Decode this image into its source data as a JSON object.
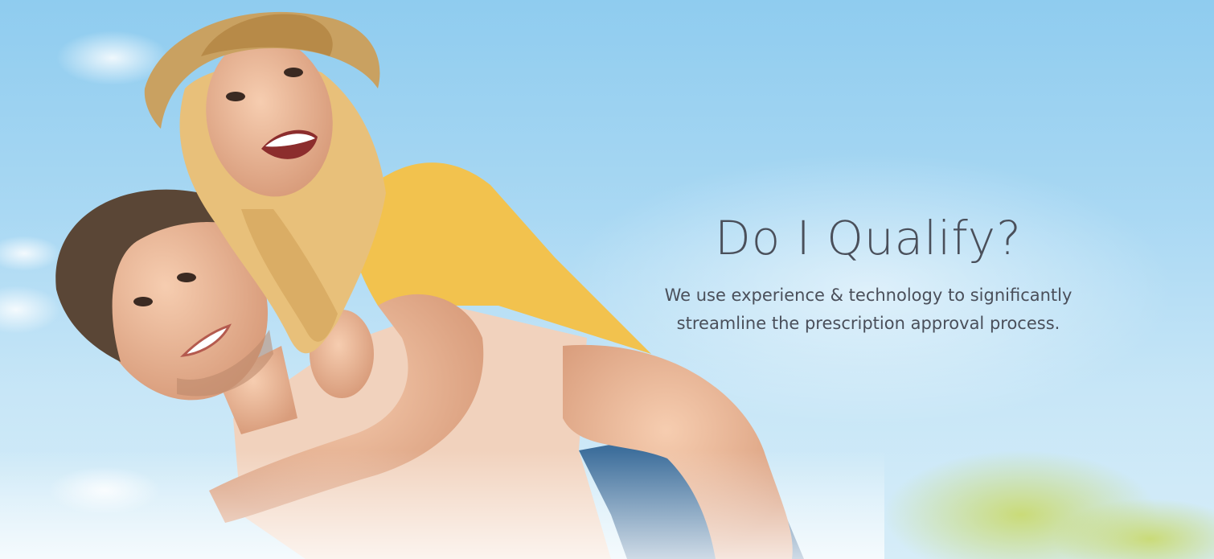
{
  "hero": {
    "headline": "Do I Qualify?",
    "subtext_line1": "We use experience & technology to significantly",
    "subtext_line2": "streamline the prescription approval process.",
    "image_alt": "Smiling man giving a laughing woman in a straw hat a piggyback ride under a blue sky"
  },
  "colors": {
    "sky_top": "#8fccef",
    "sky_bottom": "#d6edf8",
    "text": "#4a4f5a",
    "shirt_yellow": "#f2c24e",
    "shirt_peach": "#f1d2bd",
    "denim": "#3e6f9c"
  }
}
